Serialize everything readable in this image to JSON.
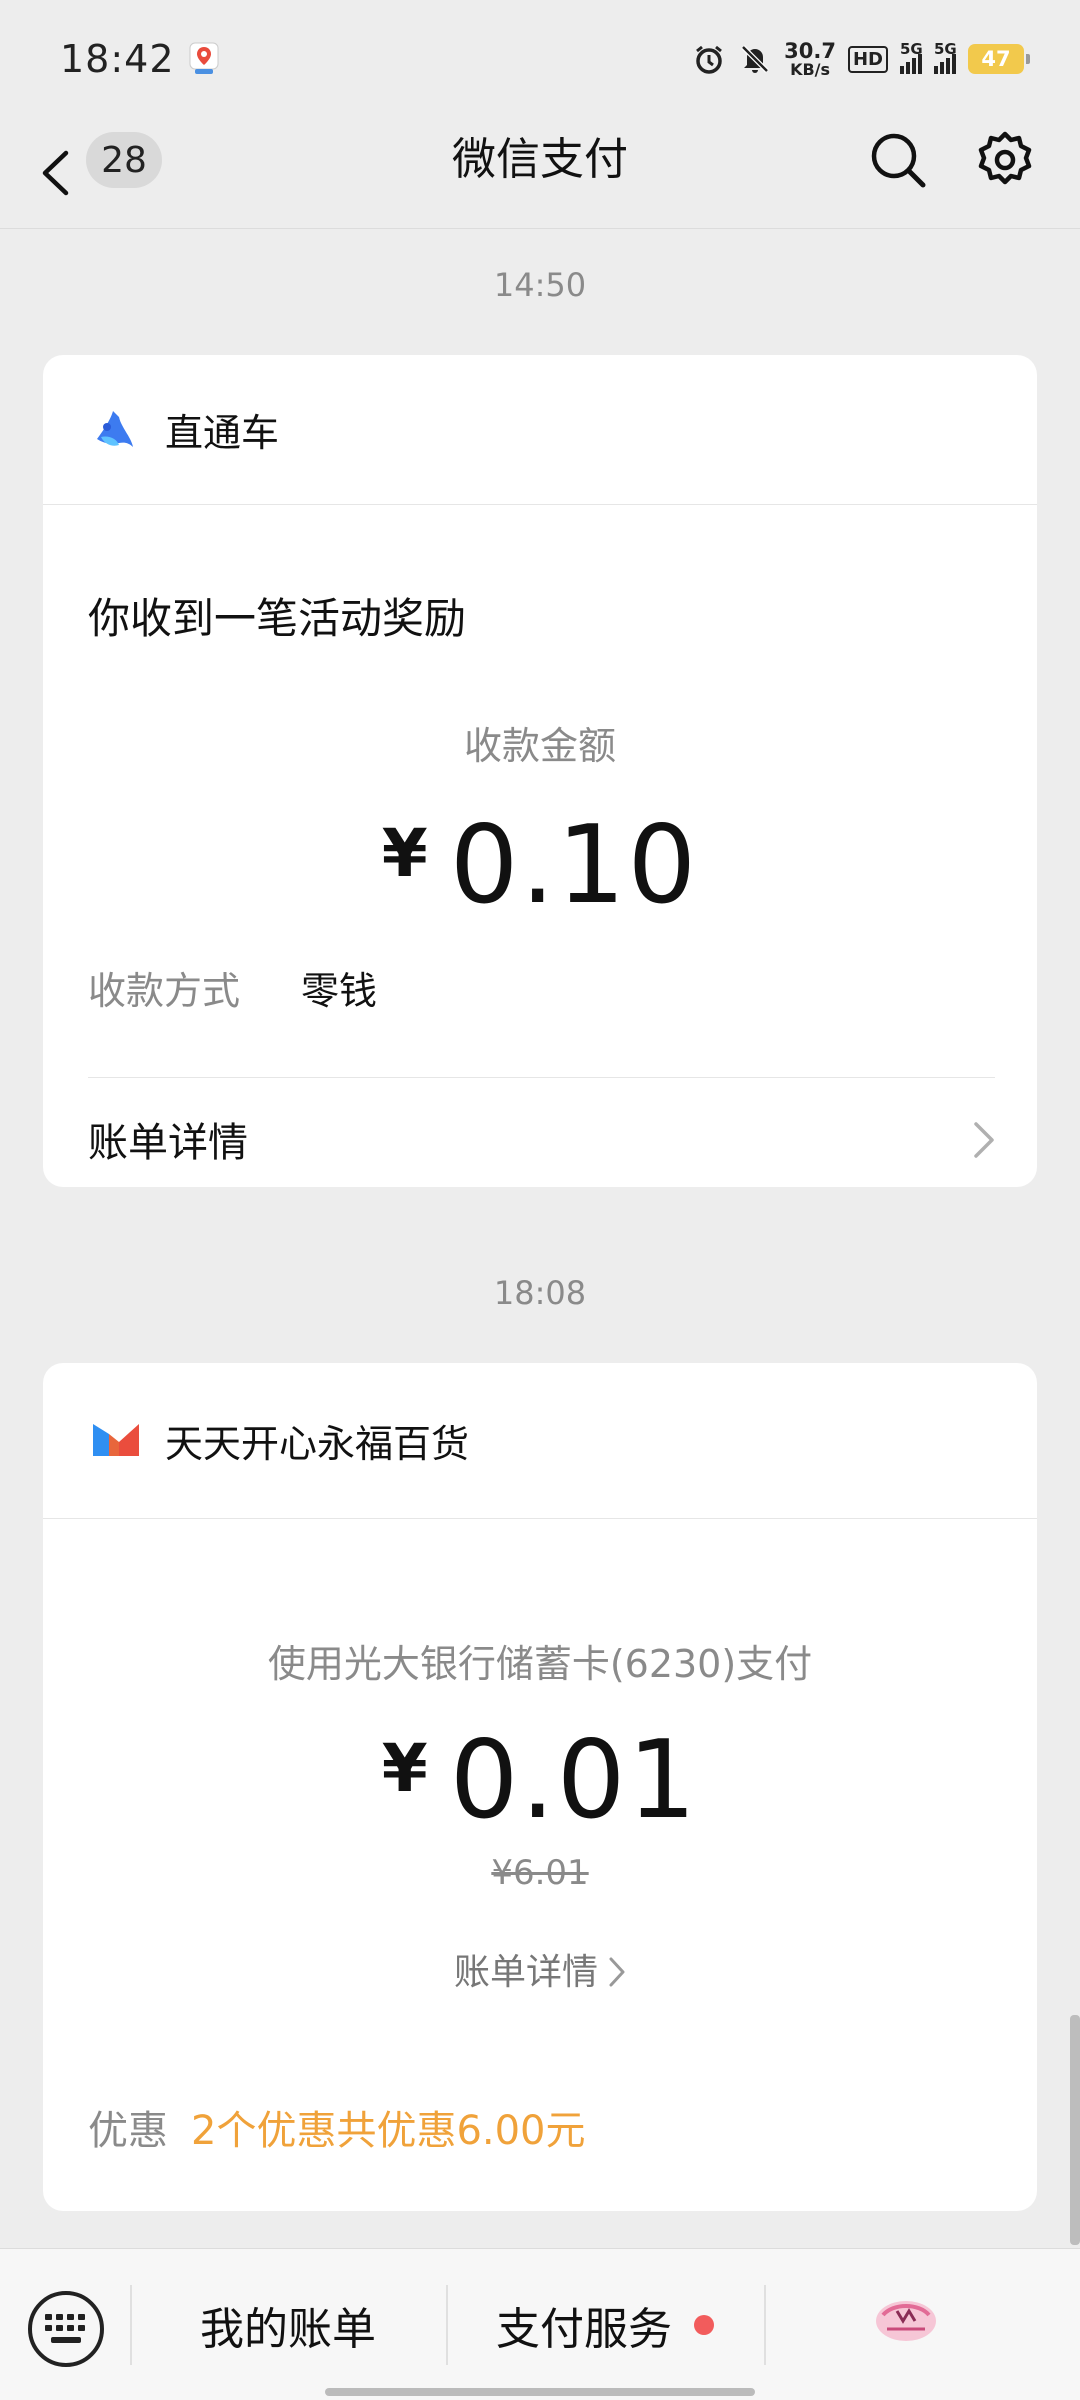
{
  "status_bar": {
    "time": "18:42",
    "net_speed_value": "30.7",
    "net_speed_unit": "KB/s",
    "hd_label": "HD",
    "sim1_label": "5G",
    "sim2_label": "5G",
    "battery": "47"
  },
  "header": {
    "unread_count": "28",
    "title": "微信支付"
  },
  "messages": [
    {
      "time": "14:50",
      "merchant": "直通车",
      "title": "你收到一笔活动奖励",
      "amount_label": "收款金额",
      "currency": "¥",
      "amount": "0.10",
      "method_label": "收款方式",
      "method_value": "零钱",
      "detail_label": "账单详情"
    },
    {
      "time": "18:08",
      "merchant": "天天开心永福百货",
      "pay_method": "使用光大银行储蓄卡(6230)支付",
      "currency": "¥",
      "amount": "0.01",
      "original_amount": "¥6.01",
      "detail_label": "账单详情",
      "discount_label": "优惠",
      "discount_value": "2个优惠共优惠6.00元"
    }
  ],
  "bottom_bar": {
    "tab_bills": "我的账单",
    "tab_services": "支付服务"
  },
  "colors": {
    "background": "#ededed",
    "discount": "#f0a23a",
    "notification_dot": "#f25c5c",
    "battery": "#f2c94c"
  }
}
